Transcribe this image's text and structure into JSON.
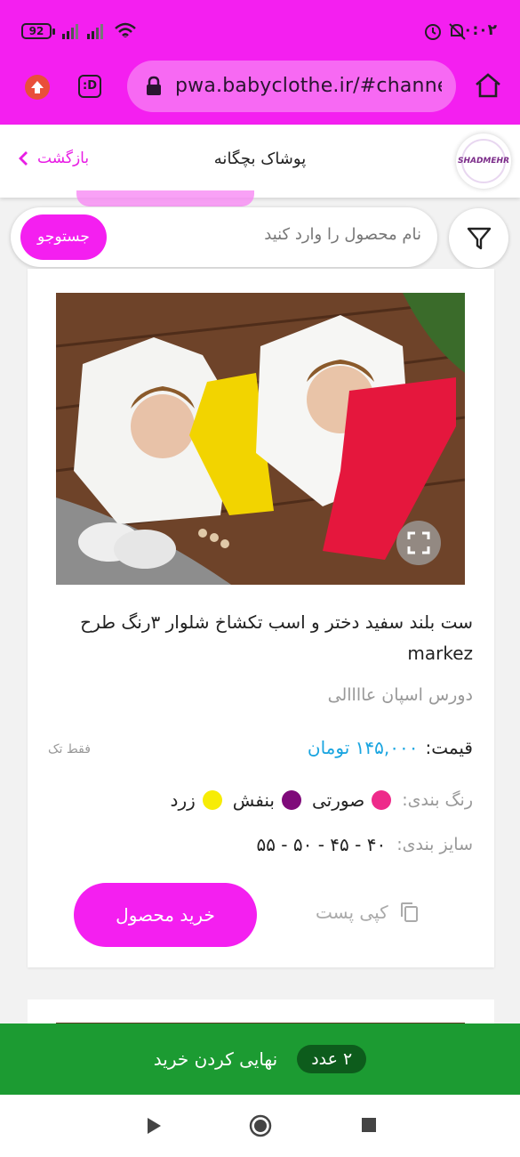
{
  "status": {
    "battery": "92",
    "time": "۰:۰۲"
  },
  "browser": {
    "url": "pwa.babyclothe.ir/#channel",
    "extension_label": ":D"
  },
  "header": {
    "title": "پوشاک بچگانه",
    "back_label": "بازگشت",
    "logo_text": "SHADMEHR"
  },
  "search": {
    "placeholder": "نام محصول را وارد کنید",
    "button_label": "جستوجو"
  },
  "product": {
    "title": "ست بلند سفید دختر و اسب تکشاخ شلوار ۳رنگ طرح markez",
    "fabric": "دورس اسپان عاااالی",
    "price_label": "قیمت:",
    "price_value": "۱۴۵,۰۰۰ تومان",
    "single_note": "فقط تک",
    "colors_label": "رنگ بندی:",
    "colors": [
      {
        "name": "صورتی",
        "hex": "#ee2a8a"
      },
      {
        "name": "بنفش",
        "hex": "#7f0a7a"
      },
      {
        "name": "زرد",
        "hex": "#f7ec06"
      }
    ],
    "sizes_label": "سایز بندی:",
    "sizes": "۴۰ - ۴۵ - ۵۰ - ۵۵",
    "copy_label": "کپی پست",
    "buy_label": "خرید محصول"
  },
  "checkout": {
    "count": "۲ عدد",
    "label": "نهایی کردن خرید"
  },
  "colors": {
    "brand": "#f41ff0",
    "checkout": "#1c9b32",
    "price": "#1aa5e0"
  }
}
